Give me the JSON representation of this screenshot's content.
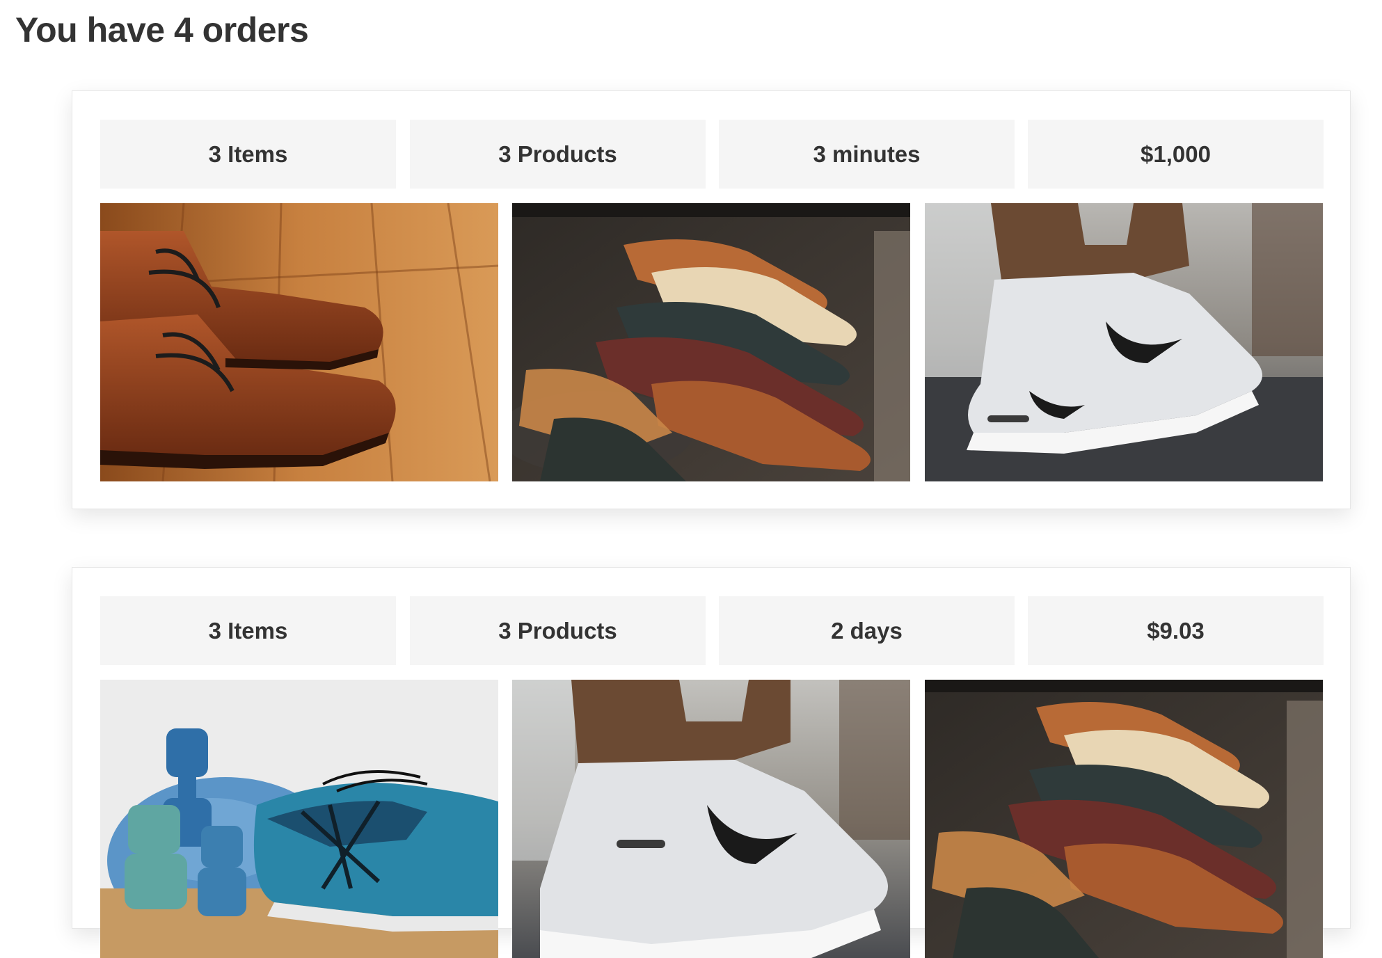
{
  "header": {
    "title": "You have 4 orders"
  },
  "orders": [
    {
      "items": "3 Items",
      "products": "3 Products",
      "time": "3 minutes",
      "total": "$1,000",
      "images": [
        "brown-leather-boots-photo",
        "dress-shoes-rack-photo",
        "white-sneaker-photo"
      ]
    },
    {
      "items": "3 Items",
      "products": "3 Products",
      "time": "2 days",
      "total": "$9.03",
      "images": [
        "dumbbells-running-shoe-photo",
        "white-sneaker-photo",
        "dress-shoes-rack-photo"
      ]
    }
  ],
  "colors": {
    "title_text": "#333333",
    "stat_background": "#f5f5f5",
    "card_border": "#e6e6e6"
  }
}
